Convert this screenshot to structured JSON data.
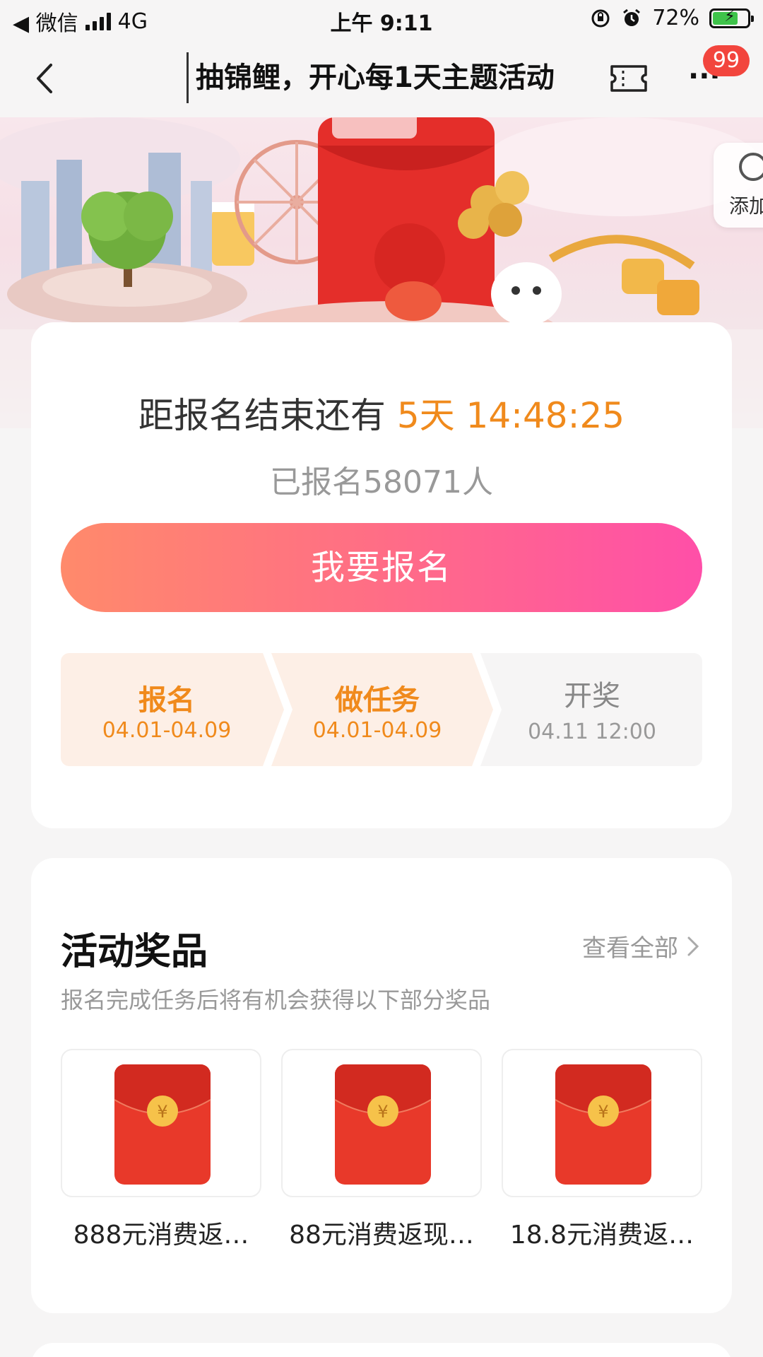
{
  "status_bar": {
    "carrier": "◀ 微信",
    "network": "4G",
    "time": "上午 9:11",
    "battery": "72%",
    "battery_level": 0.72
  },
  "nav": {
    "title": "抽锦鲤，开心每1天主题活动",
    "more_label": "···",
    "badge_count": "99"
  },
  "banner": {
    "side_button_label": "添加"
  },
  "signup": {
    "countdown_prefix": "距报名结束还有",
    "countdown_days": "5天",
    "countdown_time": "14:48:25",
    "signed_count": "已报名58071人",
    "button_label": "我要报名",
    "steps": [
      {
        "label": "报名",
        "date": "04.01-04.09"
      },
      {
        "label": "做任务",
        "date": "04.01-04.09"
      },
      {
        "label": "开奖",
        "date": "04.11 12:00"
      }
    ]
  },
  "prizes": {
    "title": "活动奖品",
    "view_all": "查看全部",
    "subtitle": "报名完成任务后将有机会获得以下部分奖品",
    "items": [
      {
        "name": "888元消费返…"
      },
      {
        "name": "88元消费返现…"
      },
      {
        "name": "18.8元消费返…"
      }
    ]
  },
  "colors": {
    "accent_orange": "#f08a1c",
    "button_gradient_start": "#ff8a6b",
    "button_gradient_end": "#ff4fa8",
    "badge_red": "#f2453d",
    "red_packet": "#e8392a"
  }
}
